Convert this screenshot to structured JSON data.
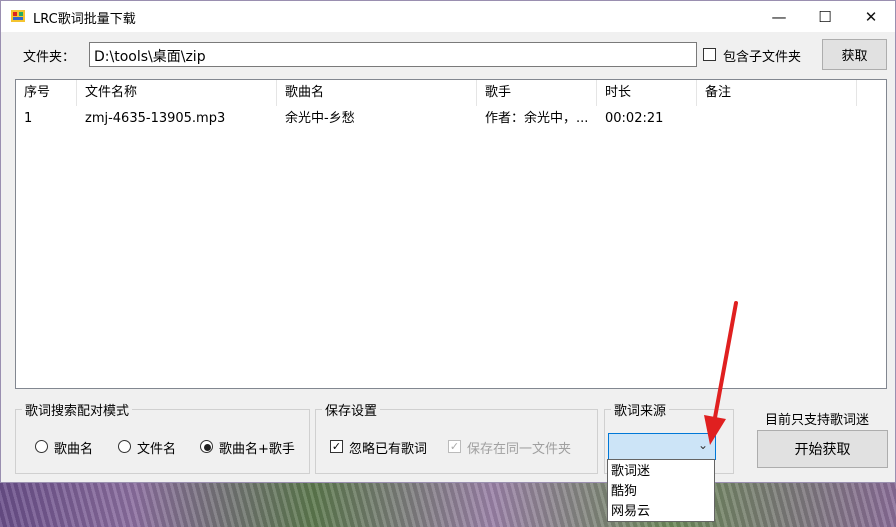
{
  "window": {
    "title": "LRC歌词批量下载",
    "minimize": "—",
    "maximize": "☐",
    "close": "✕"
  },
  "folder": {
    "label": "文件夹：",
    "value": "D:\\tools\\桌面\\zip",
    "include_sub_label": "包含子文件夹",
    "include_sub_checked": false,
    "fetch_label": "获取"
  },
  "table": {
    "columns": [
      "序号",
      "文件名称",
      "歌曲名",
      "歌手",
      "时长",
      "备注"
    ],
    "rows": [
      [
        "1",
        "zmj-4635-13905.mp3",
        "余光中-乡愁",
        "作者：余光中，...",
        "00:02:21",
        ""
      ]
    ]
  },
  "search_mode": {
    "title": "歌词搜索配对模式",
    "options": [
      "歌曲名",
      "文件名",
      "歌曲名+歌手"
    ],
    "selected": "歌曲名+歌手"
  },
  "save": {
    "title": "保存设置",
    "ignore_label": "忽略已有歌词",
    "ignore_checked": true,
    "same_folder_label": "保存在同一文件夹",
    "same_folder_checked": true,
    "same_folder_disabled": true
  },
  "source": {
    "title": "歌词来源",
    "value": "",
    "options": [
      "歌词迷",
      "酷狗",
      "网易云"
    ]
  },
  "support_note": "目前只支持歌词迷",
  "start_label": "开始获取",
  "colors": {
    "arrow": "#e02020",
    "combo_focus": "#0078d7",
    "combo_fill": "#cce4f7"
  }
}
